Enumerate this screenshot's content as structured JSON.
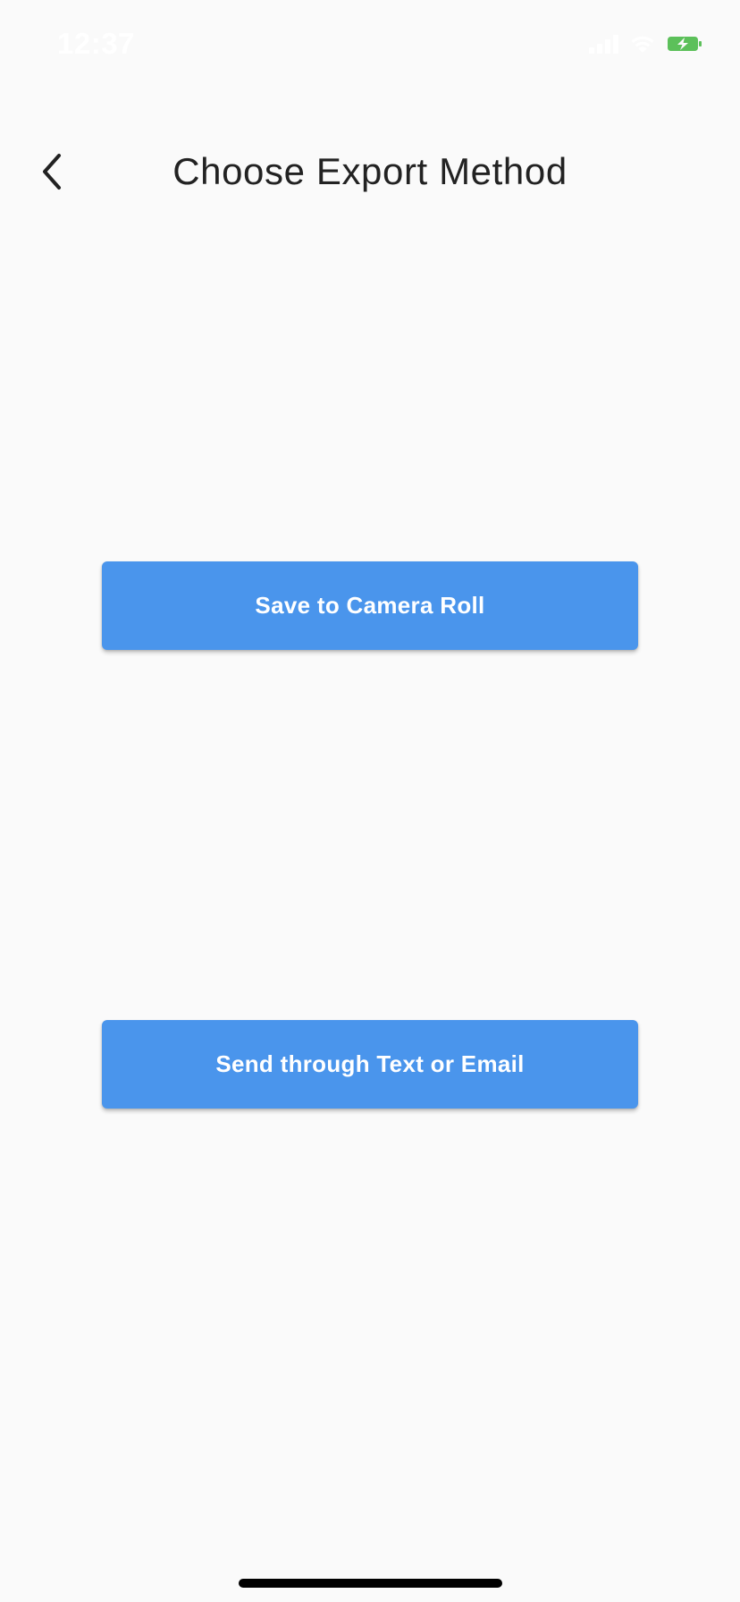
{
  "status_bar": {
    "time": "12:37",
    "icons": [
      "signal-icon",
      "wifi-icon",
      "battery-charging-icon"
    ],
    "battery_color": "#5cc05a"
  },
  "nav": {
    "back_icon": "chevron-left-icon",
    "title": "Choose Export Method"
  },
  "actions": {
    "camera_roll_label": "Save to Camera Roll",
    "send_label": "Send through Text or Email"
  },
  "colors": {
    "background": "#fafafa",
    "button": "#4a95ec",
    "button_text": "#ffffff",
    "title_text": "#222222"
  }
}
